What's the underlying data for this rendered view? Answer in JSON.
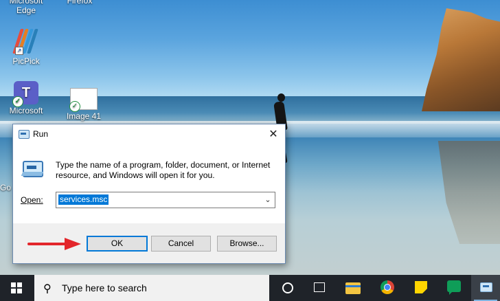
{
  "desktop": {
    "icons": [
      {
        "label": "Microsoft Edge",
        "line1": "Microsoft",
        "line2": "Edge"
      },
      {
        "label": "Firefox",
        "line1": "Firefox"
      },
      {
        "label": "PicPick"
      },
      {
        "label": "Microsoft Teams",
        "line1": "Microsoft"
      },
      {
        "label": "Image 41"
      },
      {
        "label": "Go"
      }
    ]
  },
  "run_dialog": {
    "title": "Run",
    "close_glyph": "✕",
    "instructions": "Type the name of a program, folder, document, or Internet resource, and Windows will open it for you.",
    "open_label": "Open:",
    "open_value": "services.msc",
    "dropdown_glyph": "⌄",
    "ok_label": "OK",
    "cancel_label": "Cancel",
    "browse_label": "Browse..."
  },
  "taskbar": {
    "search_placeholder": "Type here to search",
    "search_icon": "⚲",
    "apps": [
      "cortana-icon",
      "task-view-icon",
      "file-explorer-icon",
      "chrome-icon",
      "sticky-notes-icon",
      "hangouts-icon",
      "run-icon"
    ]
  },
  "colors": {
    "accent": "#0078d7",
    "taskbar": "#1f2329",
    "arrow": "#e3262b"
  }
}
